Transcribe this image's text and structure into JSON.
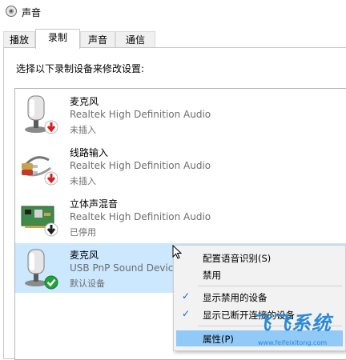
{
  "window": {
    "title": "声音"
  },
  "tabs": [
    {
      "label": "播放"
    },
    {
      "label": "录制"
    },
    {
      "label": "声音"
    },
    {
      "label": "通信"
    }
  ],
  "instruction": "选择以下录制设备来修改设置:",
  "devices": [
    {
      "name": "麦克风",
      "driver": "Realtek High Definition Audio",
      "status": "未插入",
      "icon": "microphone-icon",
      "badge": "unplugged-arrow-icon"
    },
    {
      "name": "线路输入",
      "driver": "Realtek High Definition Audio",
      "status": "未插入",
      "icon": "line-in-cable-icon",
      "badge": "unplugged-arrow-icon"
    },
    {
      "name": "立体声混音",
      "driver": "Realtek High Definition Audio",
      "status": "已停用",
      "icon": "sound-card-icon",
      "badge": "disabled-arrow-icon"
    },
    {
      "name": "麦克风",
      "driver": "USB PnP Sound Device",
      "status": "默认设备",
      "icon": "microphone-icon",
      "badge": "default-check-icon"
    }
  ],
  "context_menu": {
    "items": [
      {
        "label": "配置语音识别(S)",
        "checked": false
      },
      {
        "label": "禁用",
        "checked": false
      },
      {
        "label": "显示禁用的设备",
        "checked": true
      },
      {
        "label": "显示已断开连接的设备",
        "checked": true
      },
      {
        "label": "属性(P)",
        "checked": false
      }
    ]
  },
  "watermark": {
    "logo": "飞飞系统",
    "url": "www.feifeixitong.com"
  },
  "colors": {
    "selection": "#cce8ff",
    "menu_hover": "#91c9f7",
    "accent": "#0a64c8",
    "unplugged_badge": "#d81e1e",
    "default_badge": "#1fa33a"
  }
}
